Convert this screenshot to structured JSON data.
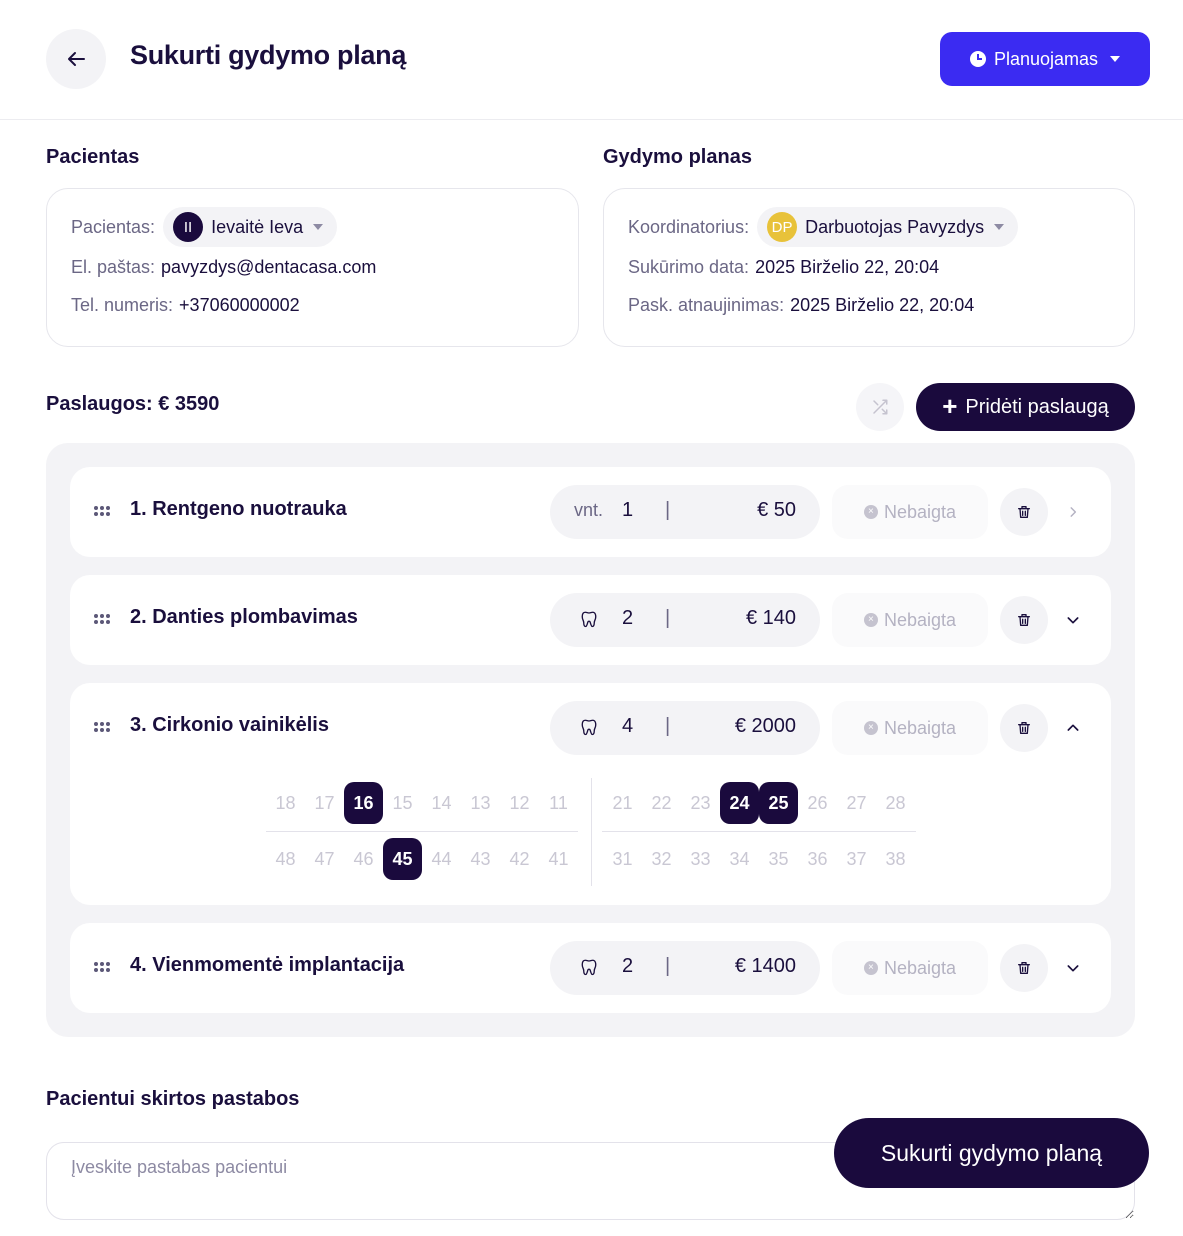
{
  "header": {
    "title": "Sukurti gydymo planą",
    "status_label": "Planuojamas",
    "status_color": "#3b2bf2"
  },
  "patient_section": {
    "title": "Pacientas",
    "patient_label": "Pacientas:",
    "patient_initials": "II",
    "patient_name": "Ievaitė Ieva",
    "email_label": "El. paštas:",
    "email": "pavyzdys@dentacasa.com",
    "phone_label": "Tel. numeris:",
    "phone": "+37060000002"
  },
  "plan_section": {
    "title": "Gydymo planas",
    "coordinator_label": "Koordinatorius:",
    "coordinator_initials": "DP",
    "coordinator_name": "Darbuotojas Pavyzdys",
    "created_label": "Sukūrimo data:",
    "created": "2025 Birželio 22, 20:04",
    "updated_label": "Pask. atnaujinimas:",
    "updated": "2025 Birželio 22, 20:04"
  },
  "services": {
    "title": "Paslaugos: € 3590",
    "add_label": "Pridėti paslaugą",
    "items": [
      {
        "name": "1. Rentgeno nuotrauka",
        "unit": "vnt.",
        "count": "1",
        "price": "€ 50",
        "state": "Nebaigta",
        "icon": "chevron-right-icon"
      },
      {
        "name": "2. Danties plombavimas",
        "unit": "tooth",
        "count": "2",
        "price": "€ 140",
        "state": "Nebaigta",
        "icon": "chevron-down-icon"
      },
      {
        "name": "3. Cirkonio vainikėlis",
        "unit": "tooth",
        "count": "4",
        "price": "€ 2000",
        "state": "Nebaigta",
        "icon": "chevron-up-icon"
      },
      {
        "name": "4. Vienmomentė implantacija",
        "unit": "tooth",
        "count": "2",
        "price": "€ 1400",
        "state": "Nebaigta",
        "icon": "chevron-down-icon"
      }
    ],
    "separator": "|"
  },
  "teeth_chart": {
    "upper_left": [
      "18",
      "17",
      "16",
      "15",
      "14",
      "13",
      "12",
      "11"
    ],
    "upper_right": [
      "21",
      "22",
      "23",
      "24",
      "25",
      "26",
      "27",
      "28"
    ],
    "lower_left": [
      "48",
      "47",
      "46",
      "45",
      "44",
      "43",
      "42",
      "41"
    ],
    "lower_right": [
      "31",
      "32",
      "33",
      "34",
      "35",
      "36",
      "37",
      "38"
    ],
    "selected": [
      "16",
      "24",
      "25",
      "45"
    ]
  },
  "notes": {
    "title": "Pacientui skirtos pastabos",
    "placeholder": "Įveskite pastabas pacientui"
  },
  "footer": {
    "create_label": "Sukurti gydymo planą"
  }
}
